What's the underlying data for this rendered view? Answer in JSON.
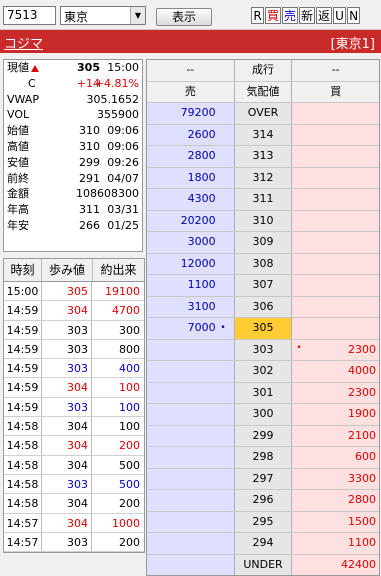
{
  "toolbar": {
    "code": "7513",
    "market": "東京",
    "show_label": "表示",
    "buttons": [
      "R",
      "買",
      "売",
      "新",
      "返",
      "U",
      "N"
    ]
  },
  "header": {
    "name": "コジマ",
    "market_tag": "[東京1]"
  },
  "info": {
    "price_label": "現値",
    "price": "305",
    "price_time": "15:00",
    "change_label": "C",
    "change": "+14",
    "change_pct": "+4.81%",
    "vwap_label": "VWAP",
    "vwap": "305.1652",
    "vol_label": "VOL",
    "vol": "355900",
    "open_label": "始値",
    "open": "310",
    "open_time": "09:06",
    "high_label": "高値",
    "high": "310",
    "high_time": "09:06",
    "low_label": "安値",
    "low": "299",
    "low_time": "09:26",
    "prev_label": "前終",
    "prev": "291",
    "prev_date": "04/07",
    "amount_label": "金額",
    "amount": "108608300",
    "yhigh_label": "年高",
    "yhigh": "311",
    "yhigh_date": "03/31",
    "ylow_label": "年安",
    "ylow": "266",
    "ylow_date": "01/25"
  },
  "ticks": {
    "headers": [
      "時刻",
      "歩み値",
      "約出来"
    ],
    "rows": [
      {
        "time": "15:00",
        "price": "305",
        "qty": "19100",
        "color": "red"
      },
      {
        "time": "14:59",
        "price": "304",
        "qty": "4700",
        "color": "red"
      },
      {
        "time": "14:59",
        "price": "303",
        "qty": "300",
        "color": "blk"
      },
      {
        "time": "14:59",
        "price": "303",
        "qty": "800",
        "color": "blk"
      },
      {
        "time": "14:59",
        "price": "303",
        "qty": "400",
        "color": "blue"
      },
      {
        "time": "14:59",
        "price": "304",
        "qty": "100",
        "color": "red"
      },
      {
        "time": "14:59",
        "price": "303",
        "qty": "100",
        "color": "blue"
      },
      {
        "time": "14:58",
        "price": "304",
        "qty": "100",
        "color": "blk"
      },
      {
        "time": "14:58",
        "price": "304",
        "qty": "200",
        "color": "red"
      },
      {
        "time": "14:58",
        "price": "304",
        "qty": "500",
        "color": "blk"
      },
      {
        "time": "14:58",
        "price": "303",
        "qty": "500",
        "color": "blue"
      },
      {
        "time": "14:58",
        "price": "304",
        "qty": "200",
        "color": "blk"
      },
      {
        "time": "14:57",
        "price": "304",
        "qty": "1000",
        "color": "red"
      },
      {
        "time": "14:57",
        "price": "303",
        "qty": "200",
        "color": "blk"
      }
    ]
  },
  "board": {
    "headers1": [
      "--",
      "成行",
      "--"
    ],
    "headers2": [
      "売",
      "気配値",
      "買"
    ],
    "rows": [
      {
        "sell": "79200",
        "price": "OVER",
        "buy": ""
      },
      {
        "sell": "2600",
        "price": "314",
        "buy": ""
      },
      {
        "sell": "2800",
        "price": "313",
        "buy": ""
      },
      {
        "sell": "1800",
        "price": "312",
        "buy": ""
      },
      {
        "sell": "4300",
        "price": "311",
        "buy": ""
      },
      {
        "sell": "20200",
        "price": "310",
        "buy": ""
      },
      {
        "sell": "3000",
        "price": "309",
        "buy": ""
      },
      {
        "sell": "12000",
        "price": "308",
        "buy": ""
      },
      {
        "sell": "1100",
        "price": "307",
        "buy": ""
      },
      {
        "sell": "3100",
        "price": "306",
        "buy": ""
      },
      {
        "sell": "7000",
        "price": "305",
        "buy": "",
        "current": true,
        "sell_dot": true
      },
      {
        "sell": "",
        "price": "303",
        "buy": "2300",
        "buy_dot": true
      },
      {
        "sell": "",
        "price": "302",
        "buy": "4000"
      },
      {
        "sell": "",
        "price": "301",
        "buy": "2300"
      },
      {
        "sell": "",
        "price": "300",
        "buy": "1900"
      },
      {
        "sell": "",
        "price": "299",
        "buy": "2100"
      },
      {
        "sell": "",
        "price": "298",
        "buy": "600"
      },
      {
        "sell": "",
        "price": "297",
        "buy": "3300"
      },
      {
        "sell": "",
        "price": "296",
        "buy": "2800"
      },
      {
        "sell": "",
        "price": "295",
        "buy": "1500"
      },
      {
        "sell": "",
        "price": "294",
        "buy": "1100"
      },
      {
        "sell": "",
        "price": "UNDER",
        "buy": "42400"
      }
    ]
  },
  "colors": {
    "header_bg": "#c92a2a",
    "sell_bg": "#dfe0ff",
    "buy_bg": "#ffe0e0",
    "current_bg": "#ffcc33"
  }
}
